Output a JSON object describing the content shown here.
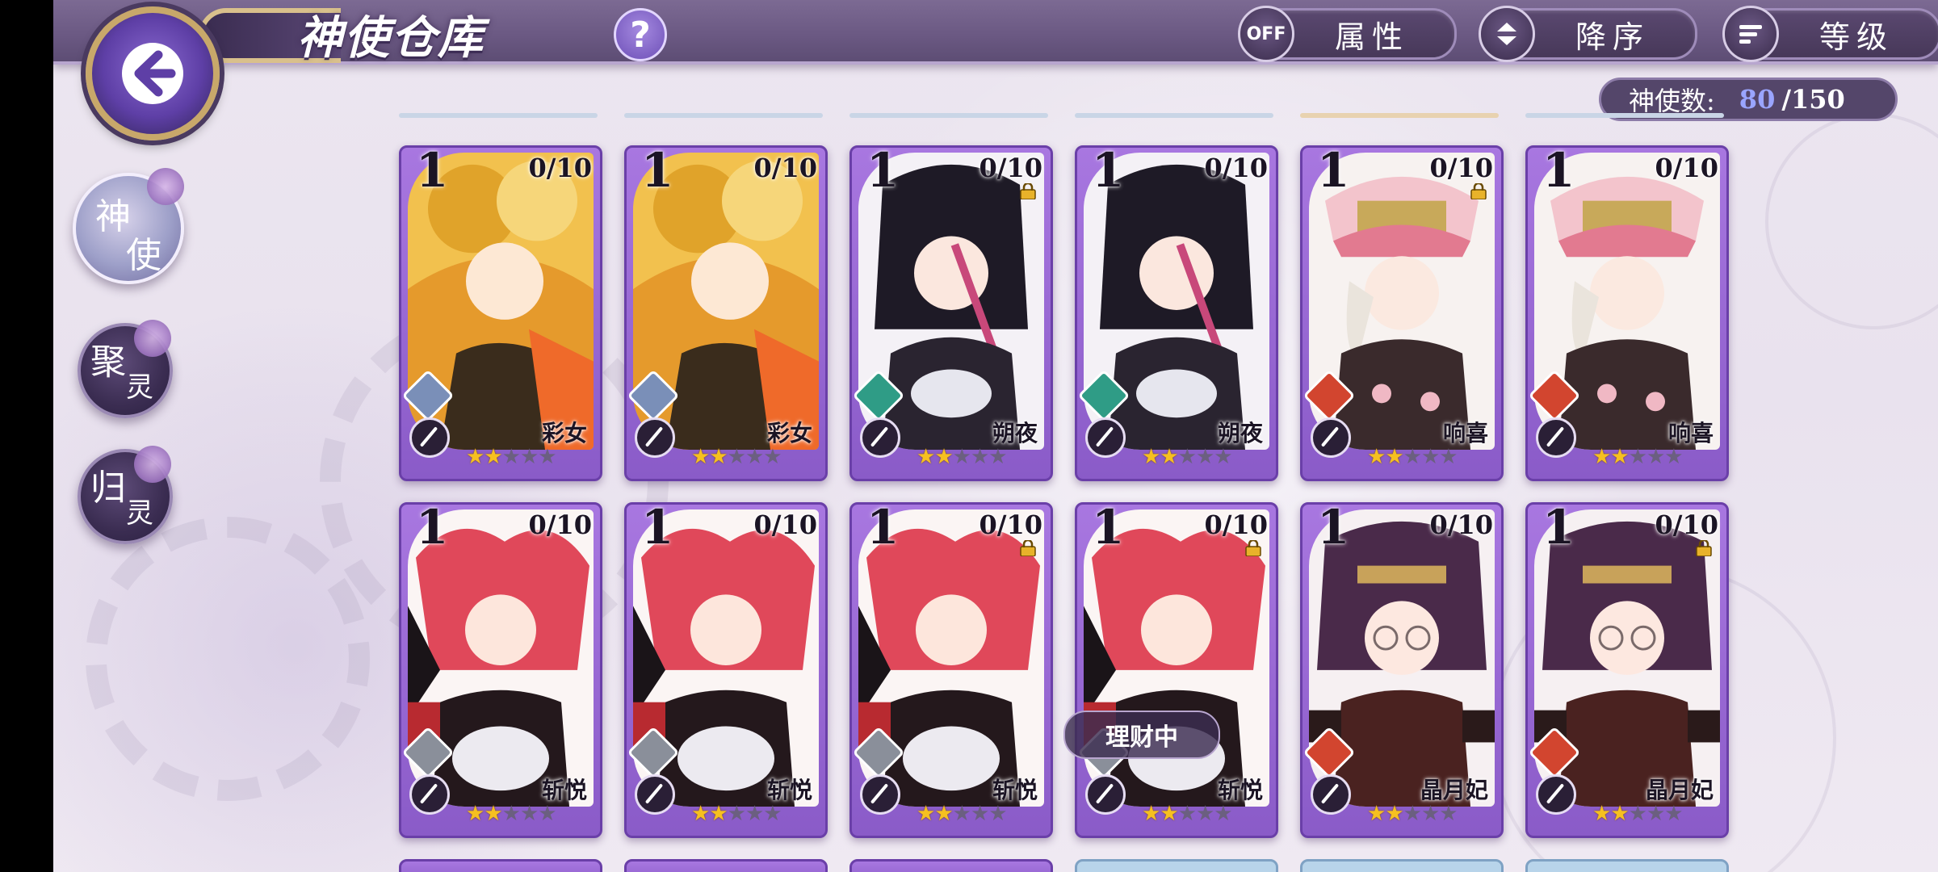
{
  "header": {
    "title": "神使仓库",
    "help_label": "?",
    "filter_toggle": "OFF",
    "filter_label": "属性",
    "sort_order_label": "降序",
    "sort_key_label": "等级"
  },
  "summary": {
    "count_label": "神使数:",
    "count_current": "80",
    "count_max": "/150"
  },
  "nav": [
    {
      "c1": "神",
      "c2": "使",
      "active": true
    },
    {
      "c1": "聚",
      "c2": "灵",
      "active": false
    },
    {
      "c1": "归",
      "c2": "灵",
      "active": false
    }
  ],
  "colors": {
    "card_purple": "#9a67d4",
    "star_on": "#f6c020",
    "count_highlight": "#9aa5ff",
    "element_blue": "#7a8fb8",
    "element_green": "#2f9c86",
    "element_red": "#d2452f",
    "element_silver": "#8a8f9a"
  },
  "cards": [
    {
      "level": "1",
      "fragments": "0/10",
      "name": "彩女",
      "locked": false,
      "element": "element_blue",
      "stars": 2,
      "art": "gold"
    },
    {
      "level": "1",
      "fragments": "0/10",
      "name": "彩女",
      "locked": false,
      "element": "element_blue",
      "stars": 2,
      "art": "gold"
    },
    {
      "level": "1",
      "fragments": "0/10",
      "name": "朔夜",
      "locked": true,
      "element": "element_green",
      "stars": 2,
      "art": "dark"
    },
    {
      "level": "1",
      "fragments": "0/10",
      "name": "朔夜",
      "locked": false,
      "element": "element_green",
      "stars": 2,
      "art": "dark"
    },
    {
      "level": "1",
      "fragments": "0/10",
      "name": "响喜",
      "locked": true,
      "element": "element_red",
      "stars": 2,
      "art": "cap"
    },
    {
      "level": "1",
      "fragments": "0/10",
      "name": "响喜",
      "locked": false,
      "element": "element_red",
      "stars": 2,
      "art": "cap"
    },
    {
      "level": "1",
      "fragments": "0/10",
      "name": "斩悦",
      "locked": false,
      "element": "element_silver",
      "stars": 2,
      "art": "red"
    },
    {
      "level": "1",
      "fragments": "0/10",
      "name": "斩悦",
      "locked": false,
      "element": "element_silver",
      "stars": 2,
      "art": "red"
    },
    {
      "level": "1",
      "fragments": "0/10",
      "name": "斩悦",
      "locked": true,
      "element": "element_silver",
      "stars": 2,
      "art": "red"
    },
    {
      "level": "1",
      "fragments": "0/10",
      "name": "斩悦",
      "locked": true,
      "element": "element_silver",
      "stars": 2,
      "art": "red",
      "badge": "理财中"
    },
    {
      "level": "1",
      "fragments": "0/10",
      "name": "晶月妃",
      "locked": false,
      "element": "element_red",
      "stars": 2,
      "art": "purple"
    },
    {
      "level": "1",
      "fragments": "0/10",
      "name": "晶月妃",
      "locked": true,
      "element": "element_red",
      "stars": 2,
      "art": "purple"
    }
  ],
  "star_total": 5
}
